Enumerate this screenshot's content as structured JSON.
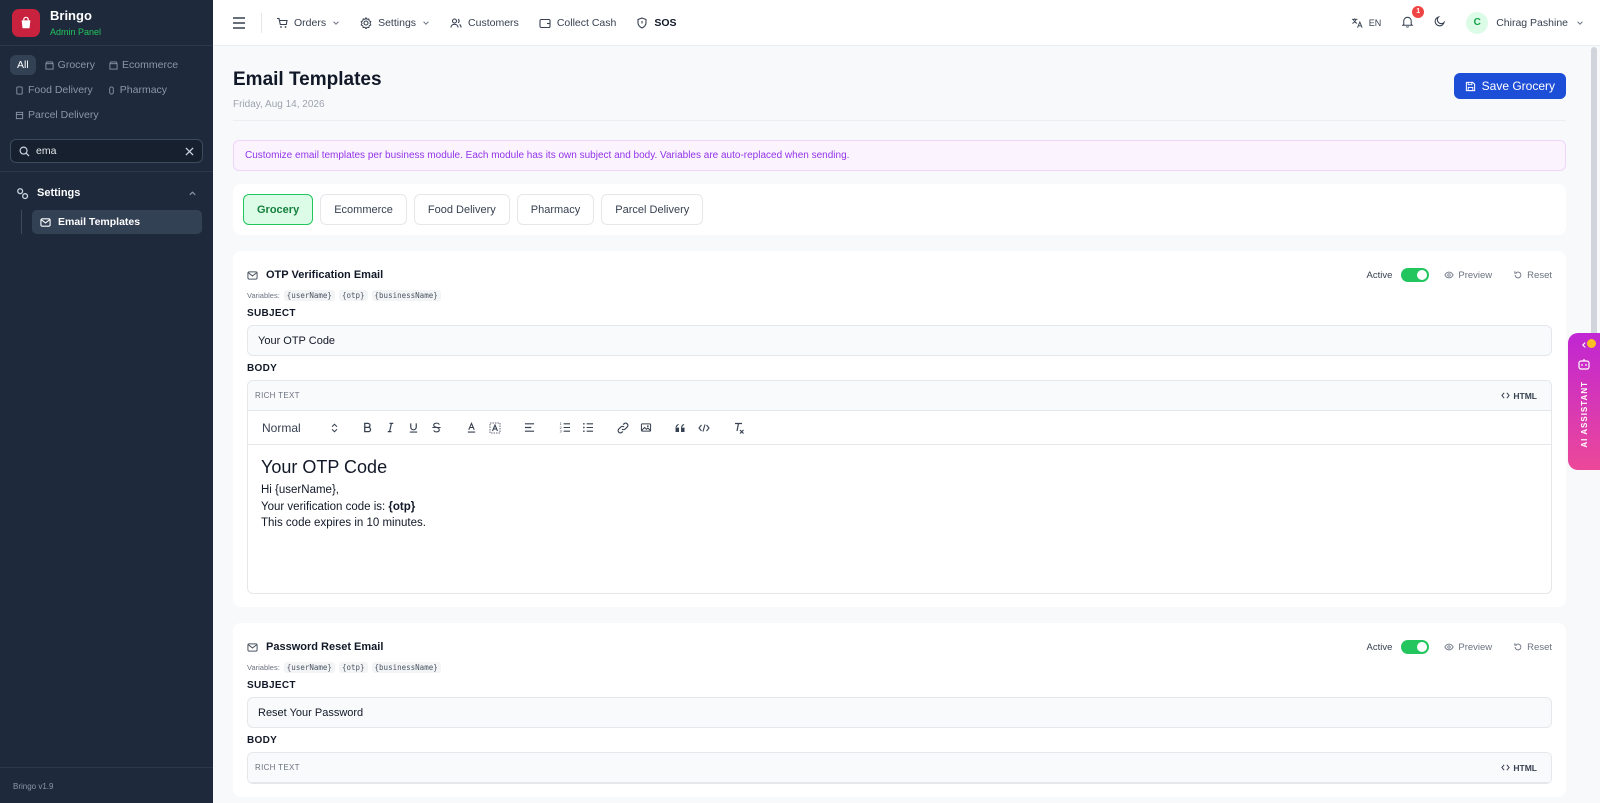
{
  "brand": {
    "name": "Bringo",
    "subtitle": "Admin Panel",
    "version": "Bringo v1.9"
  },
  "modules": [
    {
      "label": "All",
      "active": true
    },
    {
      "label": "Grocery",
      "active": false
    },
    {
      "label": "Ecommerce",
      "active": false
    },
    {
      "label": "Food Delivery",
      "active": false
    },
    {
      "label": "Pharmacy",
      "active": false
    },
    {
      "label": "Parcel Delivery",
      "active": false
    }
  ],
  "search": {
    "value": "ema"
  },
  "nav": {
    "group_label": "Settings",
    "active_item": "Email Templates"
  },
  "topbar": {
    "orders": "Orders",
    "settings": "Settings",
    "customers": "Customers",
    "collect_cash": "Collect Cash",
    "sos": "SOS",
    "lang": "EN",
    "notif_count": "1",
    "user_initial": "C",
    "user_name": "Chirag Pashine"
  },
  "page": {
    "title": "Email Templates",
    "date": "Friday, Aug 14, 2026",
    "save_label": "Save Grocery",
    "info": "Customize email templates per business module. Each module has its own subject and body. Variables are auto-replaced when sending."
  },
  "tabs": [
    "Grocery",
    "Ecommerce",
    "Food Delivery",
    "Pharmacy",
    "Parcel Delivery"
  ],
  "labels": {
    "active": "Active",
    "preview": "Preview",
    "reset": "Reset",
    "variables": "Variables:",
    "subject": "SUBJECT",
    "body": "BODY",
    "rich_text": "RICH TEXT",
    "html": "HTML",
    "format": "Normal"
  },
  "templates": [
    {
      "title": "OTP Verification Email",
      "variables": [
        "{userName}",
        "{otp}",
        "{businessName}"
      ],
      "subject": "Your OTP Code",
      "body_heading": "Your OTP Code",
      "body_line1": "Hi {userName},",
      "body_line2_prefix": "Your verification code is: ",
      "body_line2_bold": "{otp}",
      "body_line3": "This code expires in 10 minutes."
    },
    {
      "title": "Password Reset Email",
      "variables": [
        "{userName}",
        "{otp}",
        "{businessName}"
      ],
      "subject": "Reset Your Password"
    }
  ],
  "ai_assistant": "AI ASSISTANT",
  "colors": {
    "sidebar": "#1e2a3b",
    "primary": "#1d4ed8",
    "active_green": "#22c55e",
    "brand_red": "#c8223f",
    "ai_gradient": "#c026d3"
  }
}
